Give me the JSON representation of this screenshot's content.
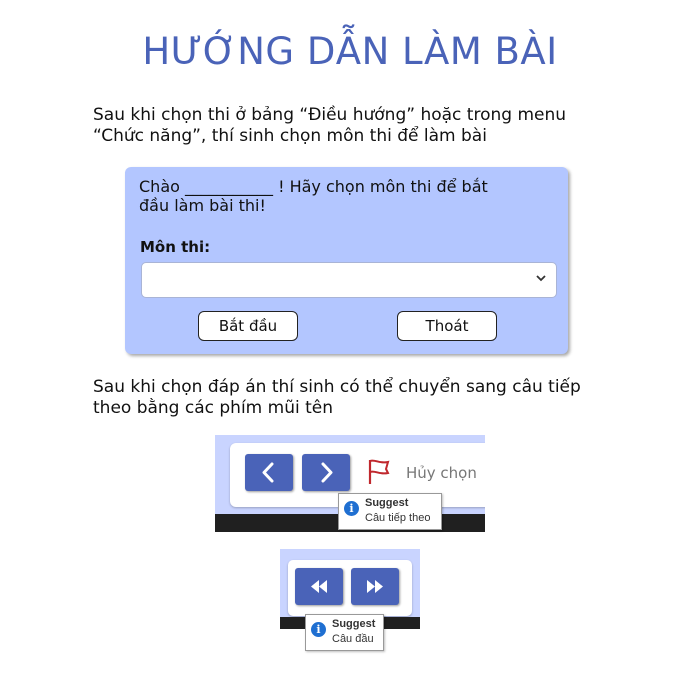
{
  "title": "HƯỚNG DẪN LÀM BÀI",
  "intro": {
    "line1": "Sau khi chọn thi ở bảng “Điều hướng” hoặc trong menu",
    "line2": "“Chức năng”, thí sinh chọn môn thi để làm bài"
  },
  "dialog": {
    "greeting_line1": "Chào ___________ ! Hãy chọn môn thi để bắt",
    "greeting_line2": "đầu làm bài thi!",
    "subject_label": "Môn thi:",
    "subject_value": "",
    "start_label": "Bắt đầu",
    "exit_label": "Thoát",
    "select_icon": "chevron-down-icon"
  },
  "instruction2": {
    "line1": "Sau khi chọn đáp án thí sinh có thể chuyển sang câu tiếp",
    "line2": "theo bằng các phím mũi tên"
  },
  "nav1": {
    "prev_icon": "‹",
    "next_icon": "›",
    "unselect_label": "Hủy chọn",
    "tooltip_title": "Suggest",
    "tooltip_text": "Câu tiếp theo"
  },
  "nav2": {
    "first_icon": "◀◀",
    "last_icon": "▶▶",
    "tooltip_title": "Suggest",
    "tooltip_text": "Câu đầu"
  },
  "colors": {
    "accent": "#4a63b8",
    "panel": "#b3c6ff",
    "flag": "#c0282d"
  }
}
